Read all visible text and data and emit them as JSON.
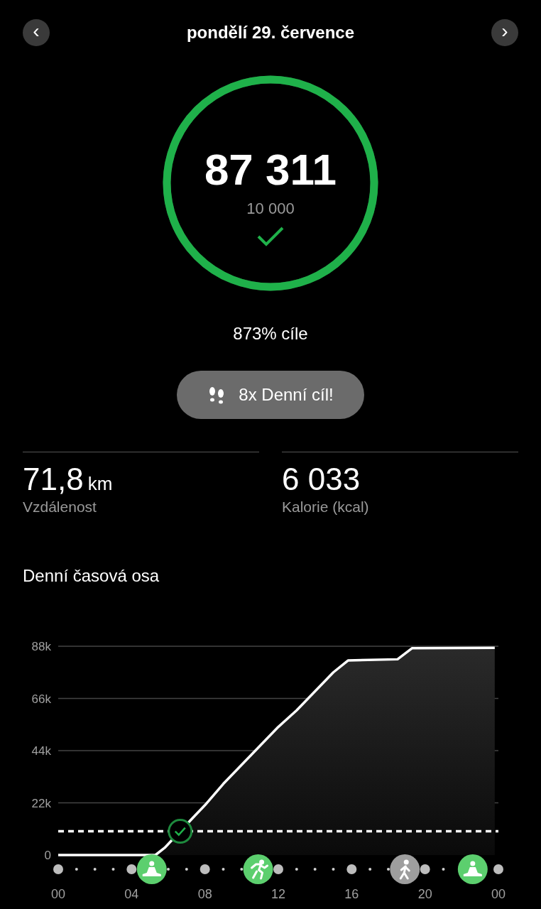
{
  "header": {
    "title": "pondělí 29. července",
    "prev": "‹",
    "next": "›"
  },
  "ring": {
    "steps": "87 311",
    "goal": "10 000",
    "level": 1,
    "goal_reached": true
  },
  "goal_percent": "873% cíle",
  "badge": {
    "label": "8x Denní cíl!"
  },
  "stats": [
    {
      "value": "71,8",
      "unit": "km",
      "label": "Vzdálenost"
    },
    {
      "value": "6 033",
      "label": "Kalorie (kcal)"
    }
  ],
  "timeline": {
    "title": "Denní časová osa",
    "chart_data": {
      "type": "area",
      "grid": true,
      "x": [
        0,
        5.3,
        5.8,
        7.5,
        8,
        9,
        10,
        11,
        12,
        13,
        14,
        15,
        15.8,
        18.5,
        19.3,
        23.8
      ],
      "series": [
        {
          "color": "#ffffff",
          "values": [
            0,
            0,
            3000,
            17000,
            21000,
            30000,
            38000,
            46000,
            54000,
            61000,
            69000,
            77000,
            82000,
            82500,
            87200,
            87300
          ]
        }
      ],
      "xlim": [
        0,
        24
      ],
      "ylim": [
        0,
        88000
      ],
      "xticks": [
        {
          "value": 0,
          "label": "00"
        },
        {
          "value": 4,
          "label": "04"
        },
        {
          "value": 8,
          "label": "08"
        },
        {
          "value": 12,
          "label": "12"
        },
        {
          "value": 16,
          "label": "16"
        },
        {
          "value": 20,
          "label": "20"
        },
        {
          "value": 24,
          "label": "00"
        }
      ],
      "yticks": [
        {
          "value": 0,
          "label": "0"
        },
        {
          "value": 22000,
          "label": "22k"
        },
        {
          "value": 44000,
          "label": "44k"
        },
        {
          "value": 66000,
          "label": "66k"
        },
        {
          "value": 88000,
          "label": "88k"
        }
      ],
      "ref_lines": [
        {
          "axis": "y",
          "value": 10000
        }
      ]
    },
    "activities": [
      {
        "kind": "meditation",
        "color": "#5ccf6e"
      },
      {
        "kind": "running",
        "color": "#5ccf6e"
      },
      {
        "kind": "walking",
        "color": "#9e9e9e"
      },
      {
        "kind": "meditation",
        "color": "#5ccf6e"
      }
    ]
  }
}
